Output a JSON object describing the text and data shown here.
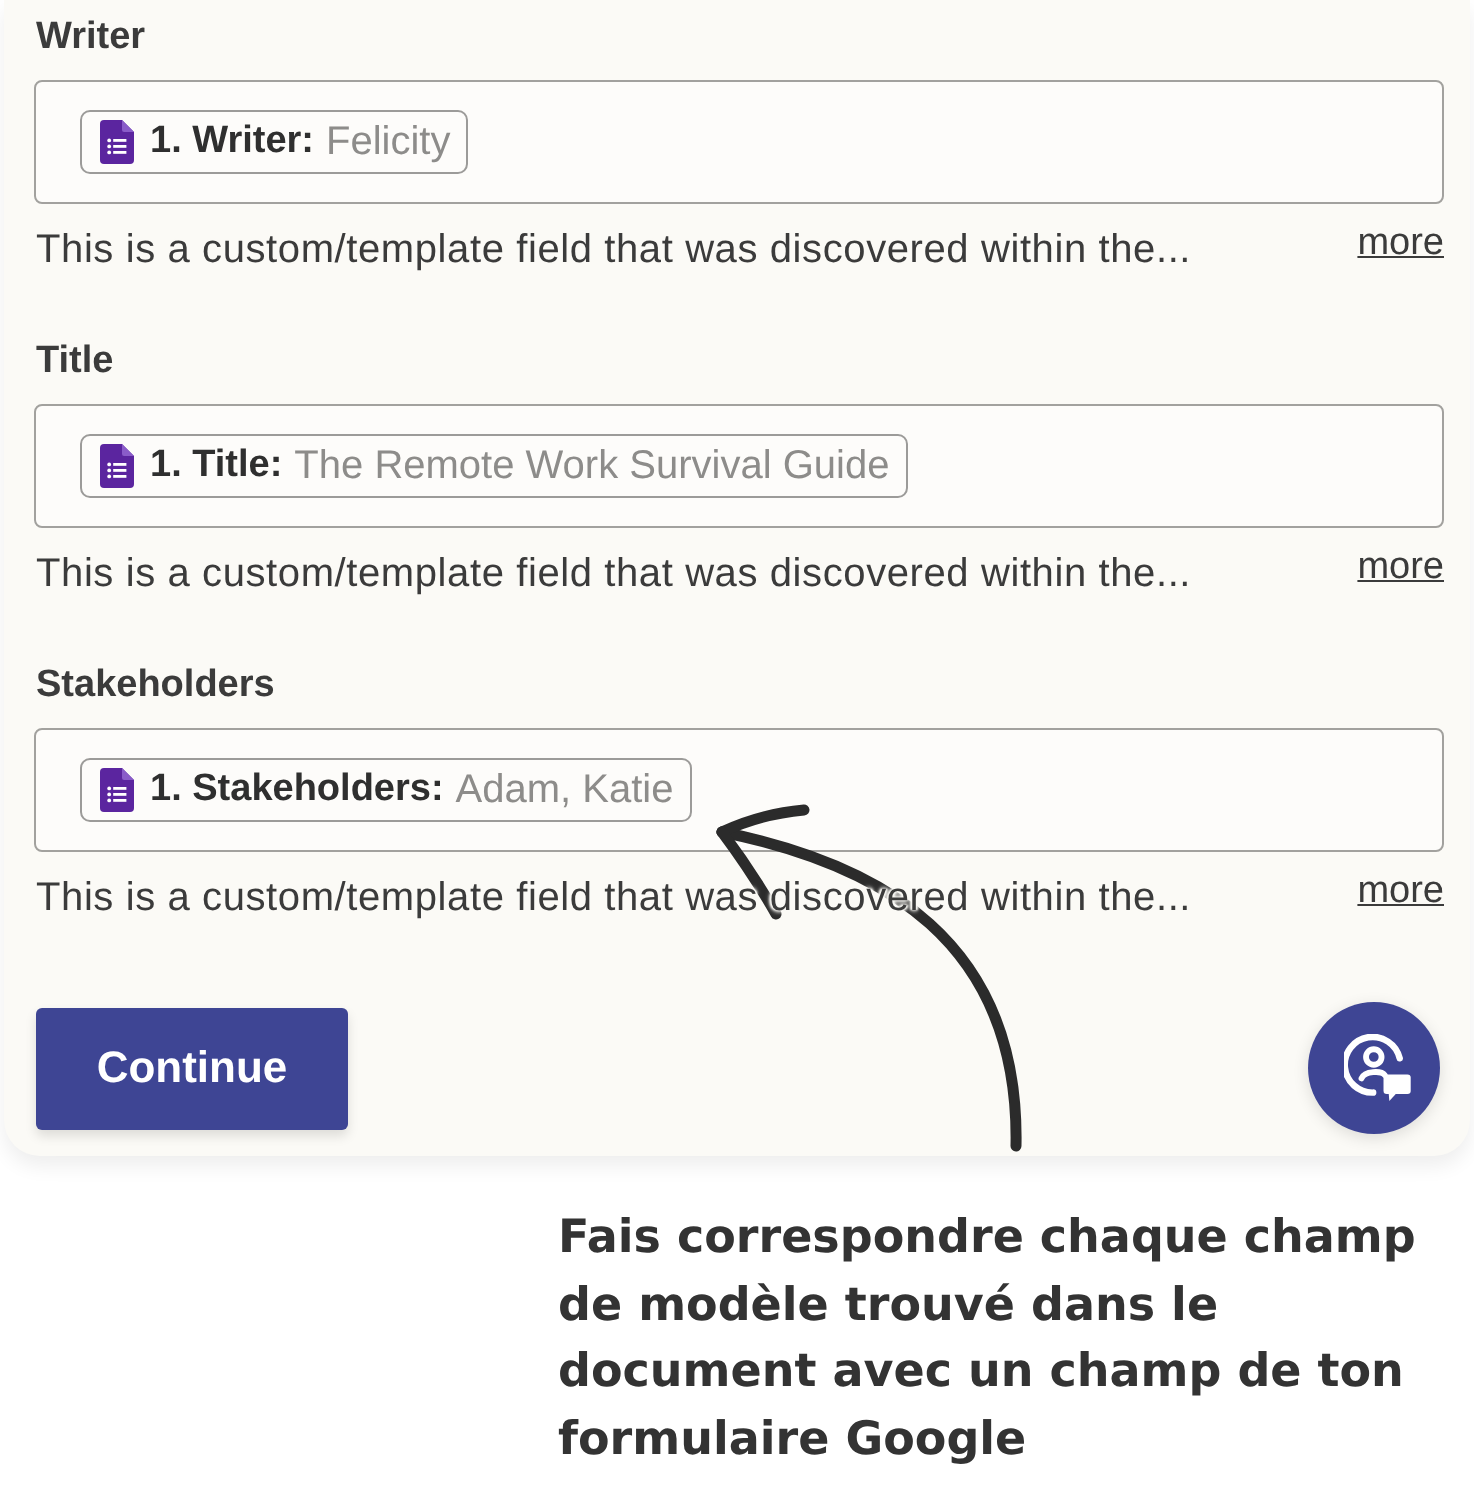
{
  "fields": [
    {
      "label": "Writer",
      "token": {
        "name": "1. Writer:",
        "value": "Felicity"
      },
      "description": "This is a custom/template field that was discovered within the...",
      "more_link": "more"
    },
    {
      "label": "Title",
      "token": {
        "name": "1. Title:",
        "value": "The Remote Work Survival Guide"
      },
      "description": "This is a custom/template field that was discovered within the...",
      "more_link": "more"
    },
    {
      "label": "Stakeholders",
      "token": {
        "name": "1. Stakeholders:",
        "value": "Adam, Katie"
      },
      "description": "This is a custom/template field that was discovered within the...",
      "more_link": "more"
    }
  ],
  "continue_button": "Continue",
  "caption": "Fais correspondre chaque champ de modèle trouvé dans le document avec un champ de ton formulaire Google"
}
